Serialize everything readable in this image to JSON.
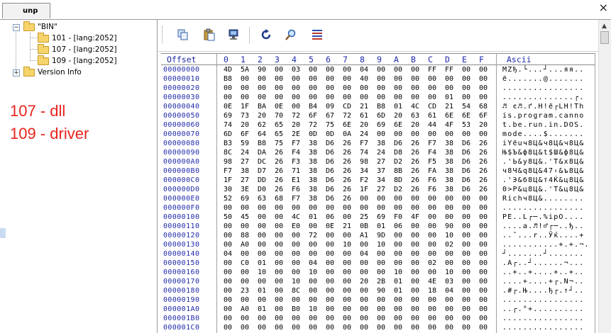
{
  "tab": {
    "label": "unp"
  },
  "tree": {
    "root": "\"BIN\"",
    "children": [
      "101 - [lang:2052]",
      "107 - [lang:2052]",
      "109 - [lang:2052]"
    ],
    "sibling": "Version Info"
  },
  "notes": [
    "107 - dll",
    "109 - driver"
  ],
  "toolbar": {
    "icons": [
      "copy-icon",
      "paste-icon",
      "paste-write-icon",
      "refresh-icon",
      "find-icon",
      "hex-view-icon"
    ]
  },
  "hex": {
    "headers": {
      "offset": "Offset",
      "cols": [
        "0",
        "1",
        "2",
        "3",
        "4",
        "5",
        "6",
        "7",
        "8",
        "9",
        "A",
        "B",
        "C",
        "D",
        "E",
        "F"
      ],
      "ascii": "Ascii"
    },
    "rows": [
      {
        "offset": "00000000",
        "bytes": [
          "4D",
          "5A",
          "90",
          "00",
          "03",
          "00",
          "00",
          "00",
          "04",
          "00",
          "00",
          "00",
          "FF",
          "FF",
          "00",
          "00"
        ],
        "ascii": "MZђ.└...┘...яя.."
      },
      {
        "offset": "00000010",
        "bytes": [
          "B8",
          "00",
          "00",
          "00",
          "00",
          "00",
          "00",
          "00",
          "40",
          "00",
          "00",
          "00",
          "00",
          "00",
          "00",
          "00"
        ],
        "ascii": "ё.......@......."
      },
      {
        "offset": "00000020",
        "bytes": [
          "00",
          "00",
          "00",
          "00",
          "00",
          "00",
          "00",
          "00",
          "00",
          "00",
          "00",
          "00",
          "00",
          "00",
          "00",
          "00"
        ],
        "ascii": "................"
      },
      {
        "offset": "00000030",
        "bytes": [
          "00",
          "00",
          "00",
          "00",
          "00",
          "00",
          "00",
          "00",
          "00",
          "00",
          "00",
          "00",
          "00",
          "01",
          "00",
          "00"
        ],
        "ascii": "..............┌."
      },
      {
        "offset": "00000040",
        "bytes": [
          "0E",
          "1F",
          "BA",
          "0E",
          "00",
          "B4",
          "09",
          "CD",
          "21",
          "B8",
          "01",
          "4C",
          "CD",
          "21",
          "54",
          "68"
        ],
        "ascii": "♬ є♬.ґ.Н!ё┌LН!Th"
      },
      {
        "offset": "00000050",
        "bytes": [
          "69",
          "73",
          "20",
          "70",
          "72",
          "6F",
          "67",
          "72",
          "61",
          "6D",
          "20",
          "63",
          "61",
          "6E",
          "6E",
          "6F"
        ],
        "ascii": "is.program.canno"
      },
      {
        "offset": "00000060",
        "bytes": [
          "74",
          "20",
          "62",
          "65",
          "20",
          "72",
          "75",
          "6E",
          "20",
          "69",
          "6E",
          "20",
          "44",
          "4F",
          "53",
          "20"
        ],
        "ascii": "t.be.run.in.DOS."
      },
      {
        "offset": "00000070",
        "bytes": [
          "6D",
          "6F",
          "64",
          "65",
          "2E",
          "0D",
          "0D",
          "0A",
          "24",
          "00",
          "00",
          "00",
          "00",
          "00",
          "00",
          "00"
        ],
        "ascii": "mode....$......."
      },
      {
        "offset": "00000080",
        "bytes": [
          "B3",
          "59",
          "B8",
          "75",
          "F7",
          "38",
          "D6",
          "26",
          "F7",
          "38",
          "D6",
          "26",
          "F7",
          "38",
          "D6",
          "26"
        ],
        "ascii": "іYёuч8Ц&ч8Ц&ч8Ц&"
      },
      {
        "offset": "00000090",
        "bytes": [
          "8C",
          "24",
          "DA",
          "26",
          "F4",
          "38",
          "D6",
          "26",
          "74",
          "24",
          "D8",
          "26",
          "F4",
          "38",
          "D6",
          "26"
        ],
        "ascii": "Њ$Ъ&ф8Ц&t$Ш&ф8Ц&"
      },
      {
        "offset": "000000A0",
        "bytes": [
          "98",
          "27",
          "DC",
          "26",
          "F3",
          "38",
          "D6",
          "26",
          "98",
          "27",
          "D2",
          "26",
          "F5",
          "38",
          "D6",
          "26"
        ],
        "ascii": ".'Ь&у8Ц&.'Т&х8Ц&"
      },
      {
        "offset": "000000B0",
        "bytes": [
          "F7",
          "38",
          "D7",
          "26",
          "71",
          "38",
          "D6",
          "26",
          "34",
          "37",
          "8B",
          "26",
          "FA",
          "38",
          "D6",
          "26"
        ],
        "ascii": "ч8Ч&q8Ц&47‹&ъ8Ц&"
      },
      {
        "offset": "000000C0",
        "bytes": [
          "1F",
          "27",
          "DD",
          "26",
          "E1",
          "38",
          "D6",
          "26",
          "F2",
          "34",
          "8D",
          "26",
          "F6",
          "38",
          "D6",
          "26"
        ],
        "ascii": ".'Э&б8Ц&т4Ќ&ц8Ц&"
      },
      {
        "offset": "000000D0",
        "bytes": [
          "30",
          "3E",
          "D0",
          "26",
          "F6",
          "38",
          "D6",
          "26",
          "1F",
          "27",
          "D2",
          "26",
          "F6",
          "38",
          "D6",
          "26"
        ],
        "ascii": "0>Р&ц8Ц&.'Т&ц8Ц&"
      },
      {
        "offset": "000000E0",
        "bytes": [
          "52",
          "69",
          "63",
          "68",
          "F7",
          "38",
          "D6",
          "26",
          "00",
          "00",
          "00",
          "00",
          "00",
          "00",
          "00",
          "00"
        ],
        "ascii": "Richч8Ц&........"
      },
      {
        "offset": "000000F0",
        "bytes": [
          "00",
          "00",
          "00",
          "00",
          "00",
          "00",
          "00",
          "00",
          "00",
          "00",
          "00",
          "00",
          "00",
          "00",
          "00",
          "00"
        ],
        "ascii": "................"
      },
      {
        "offset": "00000100",
        "bytes": [
          "50",
          "45",
          "00",
          "00",
          "4C",
          "01",
          "06",
          "00",
          "25",
          "69",
          "F0",
          "4F",
          "00",
          "00",
          "00",
          "00"
        ],
        "ascii": "PE..L┌─.%iрO...."
      },
      {
        "offset": "00000110",
        "bytes": [
          "00",
          "00",
          "00",
          "00",
          "E0",
          "00",
          "0E",
          "21",
          "0B",
          "01",
          "06",
          "00",
          "00",
          "90",
          "00",
          "00"
        ],
        "ascii": "....а.♬!♂┌─..ђ.."
      },
      {
        "offset": "00000120",
        "bytes": [
          "00",
          "88",
          "00",
          "00",
          "00",
          "72",
          "00",
          "00",
          "A1",
          "9D",
          "00",
          "00",
          "00",
          "10",
          "00",
          "00"
        ],
        "ascii": "..ˆ...r..Ўќ....+"
      },
      {
        "offset": "00000130",
        "bytes": [
          "00",
          "A0",
          "00",
          "00",
          "00",
          "00",
          "00",
          "10",
          "00",
          "10",
          "00",
          "00",
          "00",
          "02",
          "00",
          "00"
        ],
        "ascii": "...........+.+.¬."
      },
      {
        "offset": "00000140",
        "bytes": [
          "04",
          "00",
          "00",
          "00",
          "00",
          "00",
          "00",
          "00",
          "04",
          "00",
          "00",
          "00",
          "00",
          "00",
          "00",
          "00"
        ],
        "ascii": "┘.......┘......."
      },
      {
        "offset": "00000150",
        "bytes": [
          "00",
          "C0",
          "01",
          "00",
          "00",
          "04",
          "00",
          "00",
          "00",
          "00",
          "00",
          "00",
          "02",
          "00",
          "00",
          "00"
        ],
        "ascii": ".А┌..┘......¬..."
      },
      {
        "offset": "00000160",
        "bytes": [
          "00",
          "00",
          "10",
          "00",
          "00",
          "10",
          "00",
          "00",
          "00",
          "00",
          "10",
          "00",
          "00",
          "10",
          "00",
          "00"
        ],
        "ascii": "..+..+....+..+.."
      },
      {
        "offset": "00000170",
        "bytes": [
          "00",
          "00",
          "00",
          "00",
          "10",
          "00",
          "00",
          "00",
          "20",
          "2B",
          "01",
          "00",
          "4E",
          "03",
          "00",
          "00"
        ],
        "ascii": "....+....+┌.N¬.."
      },
      {
        "offset": "00000180",
        "bytes": [
          "00",
          "23",
          "01",
          "00",
          "8C",
          "00",
          "00",
          "00",
          "00",
          "90",
          "01",
          "00",
          "18",
          "04",
          "00",
          "00"
        ],
        "ascii": ".#┌.Њ....ђ┌.↑┘.."
      },
      {
        "offset": "00000190",
        "bytes": [
          "00",
          "00",
          "00",
          "00",
          "00",
          "00",
          "00",
          "00",
          "00",
          "00",
          "00",
          "00",
          "00",
          "00",
          "00",
          "00"
        ],
        "ascii": "................"
      },
      {
        "offset": "000001A0",
        "bytes": [
          "00",
          "A0",
          "01",
          "00",
          "B0",
          "10",
          "00",
          "00",
          "00",
          "00",
          "00",
          "00",
          "00",
          "00",
          "00",
          "00"
        ],
        "ascii": "..┌.°+.........."
      },
      {
        "offset": "000001B0",
        "bytes": [
          "00",
          "00",
          "00",
          "00",
          "00",
          "00",
          "00",
          "00",
          "00",
          "00",
          "00",
          "00",
          "00",
          "00",
          "00",
          "00"
        ],
        "ascii": "................"
      },
      {
        "offset": "000001C0",
        "bytes": [
          "00",
          "00",
          "00",
          "00",
          "00",
          "00",
          "00",
          "00",
          "00",
          "00",
          "00",
          "00",
          "00",
          "00",
          "00",
          "00"
        ],
        "ascii": "................"
      }
    ]
  }
}
